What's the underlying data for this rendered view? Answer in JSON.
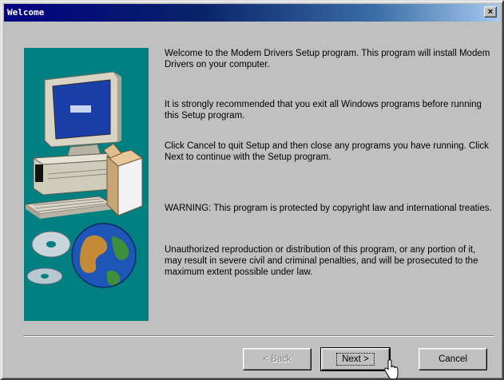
{
  "window": {
    "title": "Welcome",
    "close_glyph": "×"
  },
  "content": {
    "paragraphs": [
      "Welcome to the Modem Drivers Setup program.  This program will install Modem Drivers on your computer.",
      "It is strongly recommended that you exit all Windows programs before running this Setup program.",
      "Click Cancel to quit Setup and then close any programs you have running.  Click Next to continue with the Setup program.",
      "WARNING: This program is protected by copyright law and international treaties.",
      "Unauthorized reproduction or distribution of this program, or any portion of it, may result in severe civil and criminal penalties, and will be prosecuted to the maximum extent possible under law."
    ]
  },
  "buttons": {
    "back": "< Back",
    "next": "Next >",
    "cancel": "Cancel"
  },
  "icons": {
    "side_image": "computer-with-globe-and-cds-illustration",
    "cursor": "hand-pointer-icon"
  },
  "colors": {
    "title_bar": "#000080",
    "side_panel": "#008080",
    "dialog_face": "#c0c0c0"
  }
}
